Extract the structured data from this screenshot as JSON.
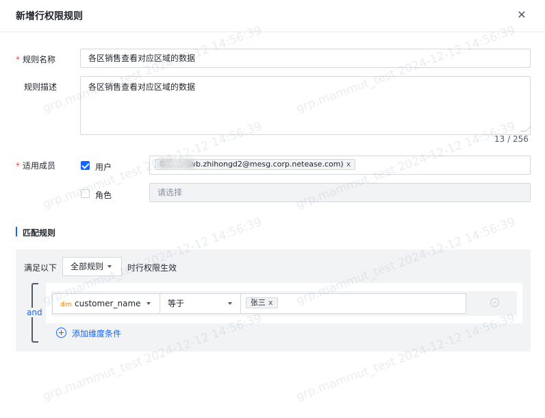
{
  "dialog": {
    "title": "新增行权限规则",
    "close_icon": "close-icon"
  },
  "form": {
    "rule_name": {
      "label": "规则名称",
      "required": "*",
      "value": "各区销售查看对应区域的数据"
    },
    "rule_desc": {
      "label": "规则描述",
      "value": "各区销售查看对应区域的数据",
      "counter": "13 / 256"
    },
    "members": {
      "label": "适用成员",
      "required": "*",
      "user": {
        "label": "用户",
        "checked": true,
        "tag": "李志法（wb.zhihongd2@mesg.corp.netease.com)",
        "tag_close": "x"
      },
      "role": {
        "label": "角色",
        "checked": false,
        "placeholder": "请选择"
      }
    }
  },
  "match": {
    "section_title": "匹配规则",
    "prefix": "满足以下",
    "mode": "全部规则",
    "suffix": "时行权限生效",
    "logic": "and",
    "condition": {
      "dim_badge": "dim",
      "field": "customer_name",
      "operator": "等于",
      "value_tag": "张三",
      "value_tag_close": "x"
    },
    "add_label": "添加维度条件"
  },
  "watermark": {
    "text": "grp.mammut_test 2024-12-12 14:56:39"
  },
  "colors": {
    "primary": "#1664ff",
    "required": "#f53f3f",
    "panel": "#f2f3f5"
  }
}
